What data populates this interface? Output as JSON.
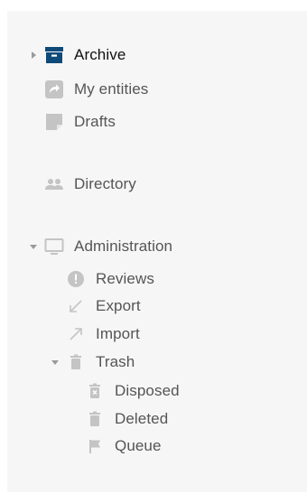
{
  "nav": {
    "archive": {
      "label": "Archive",
      "icon": "archive-icon",
      "expanded": false
    },
    "my_entities": {
      "label": "My entities",
      "icon": "share-icon"
    },
    "drafts": {
      "label": "Drafts",
      "icon": "draft-icon"
    },
    "directory": {
      "label": "Directory",
      "icon": "people-icon"
    },
    "administration": {
      "label": "Administration",
      "icon": "monitor-icon",
      "expanded": true,
      "children": {
        "reviews": {
          "label": "Reviews",
          "icon": "alert-circle-icon"
        },
        "export": {
          "label": "Export",
          "icon": "arrow-down-left-icon"
        },
        "import": {
          "label": "Import",
          "icon": "arrow-up-right-icon"
        },
        "trash": {
          "label": "Trash",
          "icon": "trash-icon",
          "expanded": true,
          "children": {
            "disposed": {
              "label": "Disposed",
              "icon": "trash-x-icon"
            },
            "deleted": {
              "label": "Deleted",
              "icon": "trash-icon"
            },
            "queue": {
              "label": "Queue",
              "icon": "flag-icon"
            }
          }
        }
      }
    }
  },
  "colors": {
    "panel_background": "#f6f6f6",
    "archive_icon": "#0d4a7a",
    "icon_gray": "#c4c4c4",
    "text_active": "#111111",
    "text": "#555555"
  }
}
